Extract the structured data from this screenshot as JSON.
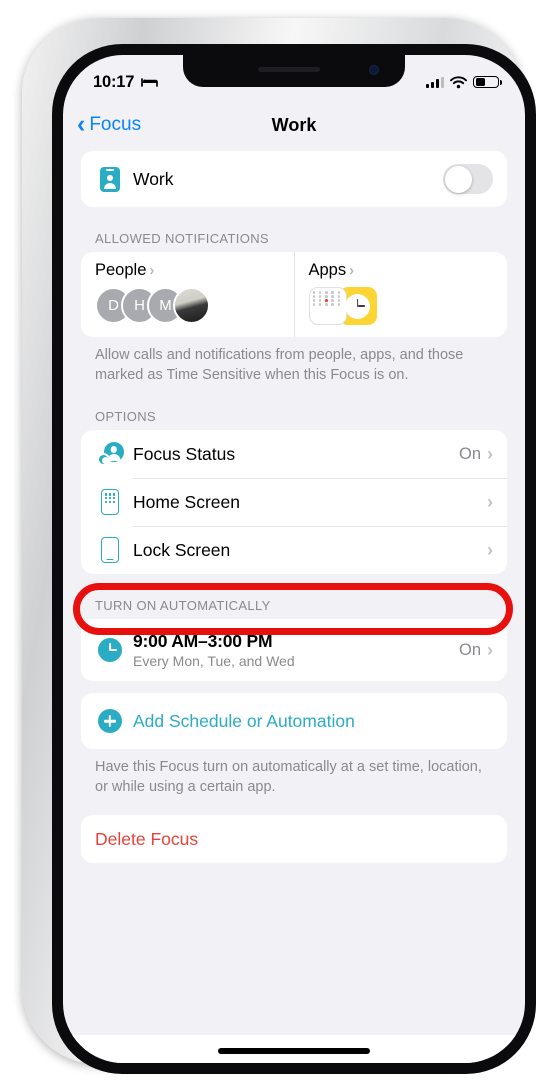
{
  "status_bar": {
    "time": "10:17",
    "sleep_icon": "bed-icon",
    "signal_icon": "cellular-signal-icon",
    "wifi_icon": "wifi-icon",
    "battery_icon": "battery-icon"
  },
  "nav": {
    "back_label": "Focus",
    "back_chevron": "‹",
    "title": "Work"
  },
  "focus_toggle_row": {
    "icon": "work-badge-icon",
    "label": "Work",
    "enabled": false
  },
  "allowed_notifications": {
    "header": "ALLOWED NOTIFICATIONS",
    "people": {
      "title": "People",
      "chevron": "›",
      "avatars": [
        "D",
        "H",
        "M",
        ""
      ]
    },
    "apps": {
      "title": "Apps",
      "chevron": "›",
      "icons": [
        "calendar-app-icon",
        "clock-app-icon"
      ]
    },
    "footer": "Allow calls and notifications from people, apps, and those marked as Time Sensitive when this Focus is on."
  },
  "options": {
    "header": "OPTIONS",
    "rows": [
      {
        "icon": "focus-status-icon",
        "label": "Focus Status",
        "value": "On",
        "chevron": "›",
        "highlighted": true
      },
      {
        "icon": "home-screen-icon",
        "label": "Home Screen",
        "value": "",
        "chevron": "›",
        "highlighted": false
      },
      {
        "icon": "lock-screen-icon",
        "label": "Lock Screen",
        "value": "",
        "chevron": "›",
        "highlighted": false
      }
    ]
  },
  "turn_on_automatically": {
    "header": "TURN ON AUTOMATICALLY",
    "schedule": {
      "icon": "clock-icon",
      "time_range": "9:00 AM–3:00 PM",
      "repeat": "Every Mon, Tue, and Wed",
      "value": "On",
      "chevron": "›"
    },
    "add_action": {
      "icon": "plus-circle-icon",
      "label": "Add Schedule or Automation"
    },
    "footer": "Have this Focus turn on automatically at a set time, location, or while using a certain app."
  },
  "delete": {
    "label": "Delete Focus"
  },
  "colors": {
    "accent_teal": "#2aadc4",
    "link_blue": "#0a84ff",
    "annotation_red": "#e8100f",
    "destructive_red": "#e8433a",
    "page_background": "#f2f1f6"
  }
}
